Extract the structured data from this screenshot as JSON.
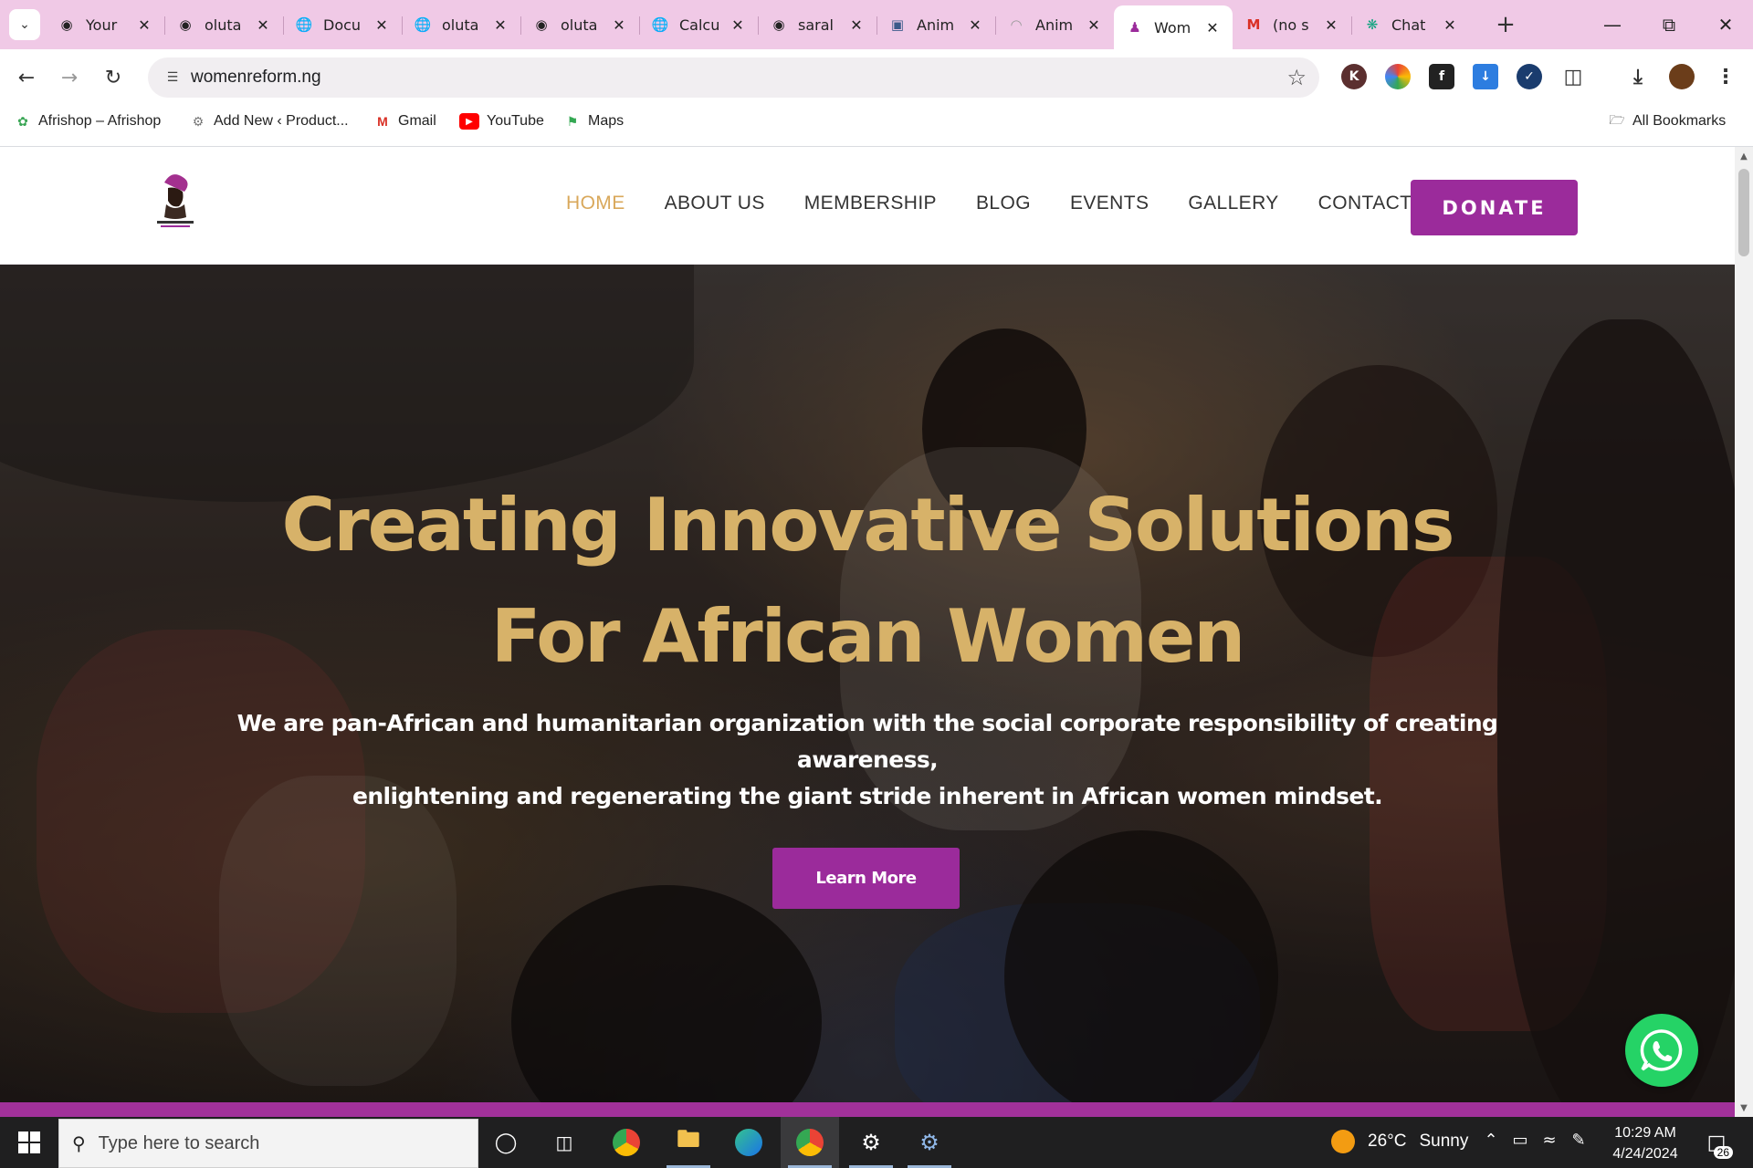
{
  "browser": {
    "tabs": [
      {
        "favicon": "github-icon",
        "title": "Your"
      },
      {
        "favicon": "github-icon",
        "title": "oluta"
      },
      {
        "favicon": "globe-icon",
        "title": "Docu"
      },
      {
        "favicon": "globe-icon",
        "title": "oluta"
      },
      {
        "favicon": "github-icon",
        "title": "oluta"
      },
      {
        "favicon": "globe-icon",
        "title": "Calcu"
      },
      {
        "favicon": "github-icon",
        "title": "saral"
      },
      {
        "favicon": "image-icon",
        "title": "Anim"
      },
      {
        "favicon": "loading-icon",
        "title": "Anim"
      },
      {
        "favicon": "women-reform-icon",
        "title": "Wom",
        "active": true
      },
      {
        "favicon": "gmail-icon",
        "title": "(no s"
      },
      {
        "favicon": "chatgpt-icon",
        "title": "Chat"
      }
    ],
    "address_bar": {
      "url": "womenreform.ng"
    },
    "bookmarks": [
      {
        "label": "Afrishop – Afrishop",
        "icon": "afrishop-icon"
      },
      {
        "label": "Add New ‹ Product...",
        "icon": "wordpress-icon"
      },
      {
        "label": "Gmail",
        "icon": "gmail-icon"
      },
      {
        "label": "YouTube",
        "icon": "youtube-icon"
      },
      {
        "label": "Maps",
        "icon": "maps-icon"
      }
    ],
    "all_bookmarks_label": "All Bookmarks"
  },
  "site": {
    "nav": [
      {
        "label": "HOME",
        "active": true
      },
      {
        "label": "ABOUT US"
      },
      {
        "label": "MEMBERSHIP"
      },
      {
        "label": "BLOG"
      },
      {
        "label": "EVENTS"
      },
      {
        "label": "GALLERY"
      },
      {
        "label": "CONTACT"
      }
    ],
    "donate_label": "DONATE",
    "hero": {
      "title_line1": "Creating Innovative Solutions",
      "title_line2": "For African Women",
      "subtitle_line1": "We are pan-African and humanitarian organization with the social corporate responsibility of creating awareness,",
      "subtitle_line2": "enlightening and regenerating the giant stride inherent in African women mindset.",
      "cta_label": "Learn More"
    },
    "colors": {
      "accent_purple": "#9b2b9b",
      "gold": "#d7b269",
      "whatsapp": "#25d366"
    }
  },
  "taskbar": {
    "search_placeholder": "Type here to search",
    "weather": {
      "temp": "26°C",
      "condition": "Sunny"
    },
    "time": "10:29 AM",
    "date": "4/24/2024",
    "notification_count": "26"
  }
}
